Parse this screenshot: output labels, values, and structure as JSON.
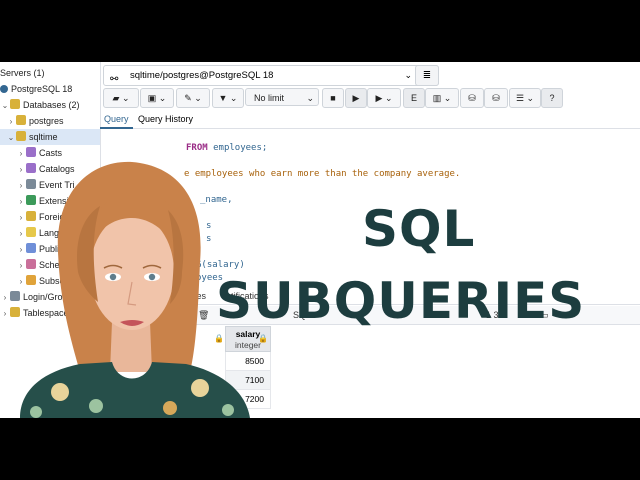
{
  "sidebar": {
    "items": [
      {
        "label": "Servers (1)",
        "chev": ""
      },
      {
        "label": "PostgreSQL 18",
        "chev": ""
      },
      {
        "label": "Databases (2)",
        "chev": "⌄"
      },
      {
        "label": "postgres",
        "chev": "›"
      },
      {
        "label": "sqltime",
        "chev": "⌄"
      },
      {
        "label": "Casts",
        "chev": "›"
      },
      {
        "label": "Catalogs",
        "chev": "›"
      },
      {
        "label": "Event Tri",
        "chev": "›"
      },
      {
        "label": "Extensio",
        "chev": "›"
      },
      {
        "label": "Foreign",
        "chev": "›"
      },
      {
        "label": "Langua",
        "chev": "›"
      },
      {
        "label": "Publica",
        "chev": "›"
      },
      {
        "label": "Schem",
        "chev": "›"
      },
      {
        "label": "Subscri",
        "chev": "›"
      },
      {
        "label": "Login/Group Ro",
        "chev": "›"
      },
      {
        "label": "Tablespaces",
        "chev": "›"
      }
    ]
  },
  "connection": {
    "label": "sqltime/postgres@PostgreSQL 18"
  },
  "toolbar": {
    "limit_label": "No limit"
  },
  "tabs": {
    "query": "Query",
    "history": "Query History"
  },
  "editor": {
    "line1_kw": "FROM",
    "line1_id": "employees;",
    "line2_cm": "e employees who earn more than the company average.",
    "line3": "_name,",
    "line4": "s",
    "line5": "s",
    "line6_fn": "G(salary)",
    "line7": "oyees"
  },
  "results": {
    "tabs_messages": "Messages",
    "tabs_notifications": "otifications",
    "tool_sql": "SQL",
    "tool_rows": "owi",
    "tool_page": "1 3"
  },
  "grid": {
    "header": "salary",
    "header_type": "integer",
    "rows": [
      "8500",
      "7100",
      "7200"
    ]
  },
  "overlay": {
    "line1": "SQL",
    "line2": "SUBQUERIES"
  }
}
